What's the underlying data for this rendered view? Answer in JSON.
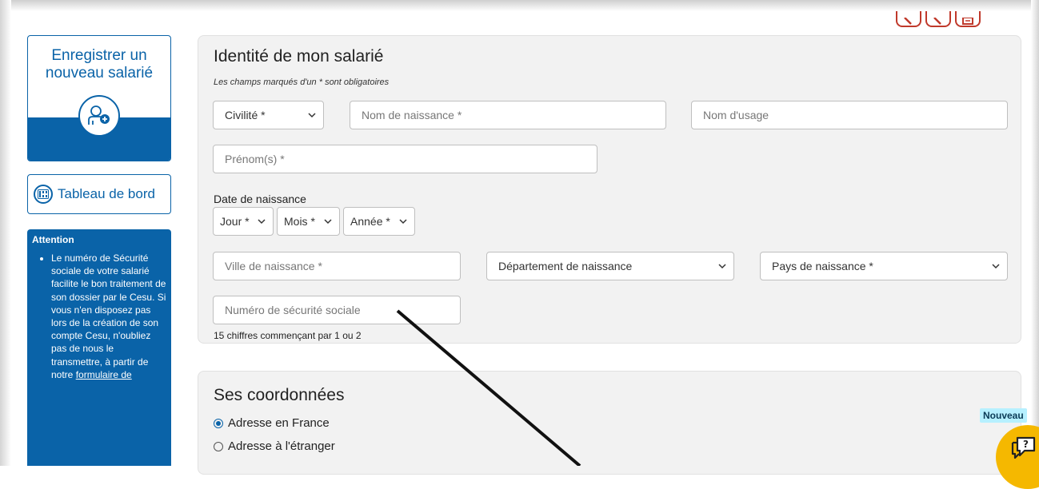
{
  "sidebar": {
    "new_employee_title": "Enregistrer un nouveau salarié",
    "dashboard_label": "Tableau de bord",
    "attention": {
      "heading": "Attention",
      "text_before_link": "Le numéro de Sécurité sociale de votre salarié facilite le bon traitement de son dossier par le Cesu. Si vous n'en disposez pas lors de la création de son compte Cesu, n'oubliez pas de nous le transmettre, à partir de notre",
      "link": "formulaire de"
    }
  },
  "identity": {
    "title": "Identité de mon salarié",
    "required_hint": "Les champs marqués d'un * sont obligatoires",
    "civilite": "Civilité *",
    "nom_naissance": "Nom de naissance *",
    "nom_usage": "Nom d'usage",
    "prenoms": "Prénom(s) *",
    "date_label": "Date de naissance",
    "jour": "Jour *",
    "mois": "Mois *",
    "annee": "Année *",
    "ville": "Ville de naissance *",
    "departement": "Département de naissance",
    "pays": "Pays de naissance *",
    "secu": "Numéro de sécurité sociale",
    "secu_help": "15 chiffres commençant par 1 ou 2"
  },
  "coords": {
    "title": "Ses coordonnées",
    "option_france": "Adresse en France",
    "option_etranger": "Adresse à l'étranger"
  },
  "chat": {
    "badge": "Nouveau"
  },
  "colors": {
    "primary": "#0a63a8",
    "accent_red": "#c0392b",
    "chat_yellow": "#f5b800"
  }
}
